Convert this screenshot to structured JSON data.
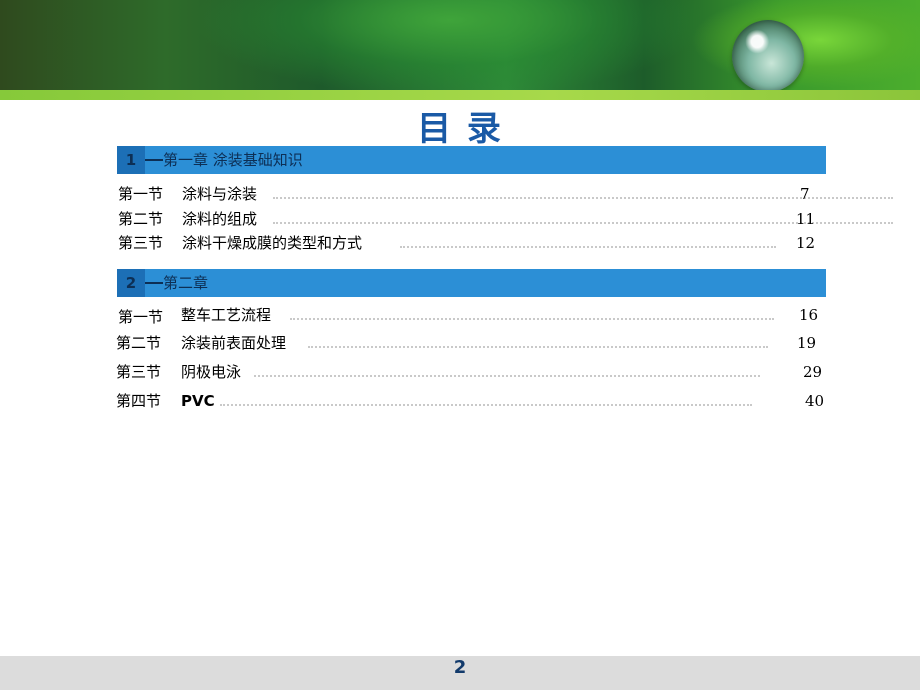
{
  "title": "目    录",
  "chapters": [
    {
      "num": "1",
      "title": "第一章  涂装基础知识",
      "entries": [
        {
          "section": "第一节",
          "name": "涂料与涂装",
          "page": "7"
        },
        {
          "section": "第二节",
          "name": "涂料的组成",
          "page": "11"
        },
        {
          "section": "第三节",
          "name": "涂料干燥成膜的类型和方式",
          "page": "12"
        }
      ]
    },
    {
      "num": "2",
      "title": "第二章",
      "entries": [
        {
          "section": "第一节",
          "name": "整车工艺流程",
          "page": "16"
        },
        {
          "section": "第二节",
          "name": "涂装前表面处理",
          "page": "19"
        },
        {
          "section": "第三节",
          "name": "阴极电泳",
          "page": "29"
        },
        {
          "section": "第四节",
          "name": "PVC",
          "page": "40"
        }
      ]
    }
  ],
  "footer": {
    "page_number": "2"
  },
  "colors": {
    "title": "#1a5aa6",
    "chapter_bar": "#2c8fd6",
    "chapter_num_bg": "#1c6fb6",
    "footer_bg": "#dcdcdc"
  }
}
